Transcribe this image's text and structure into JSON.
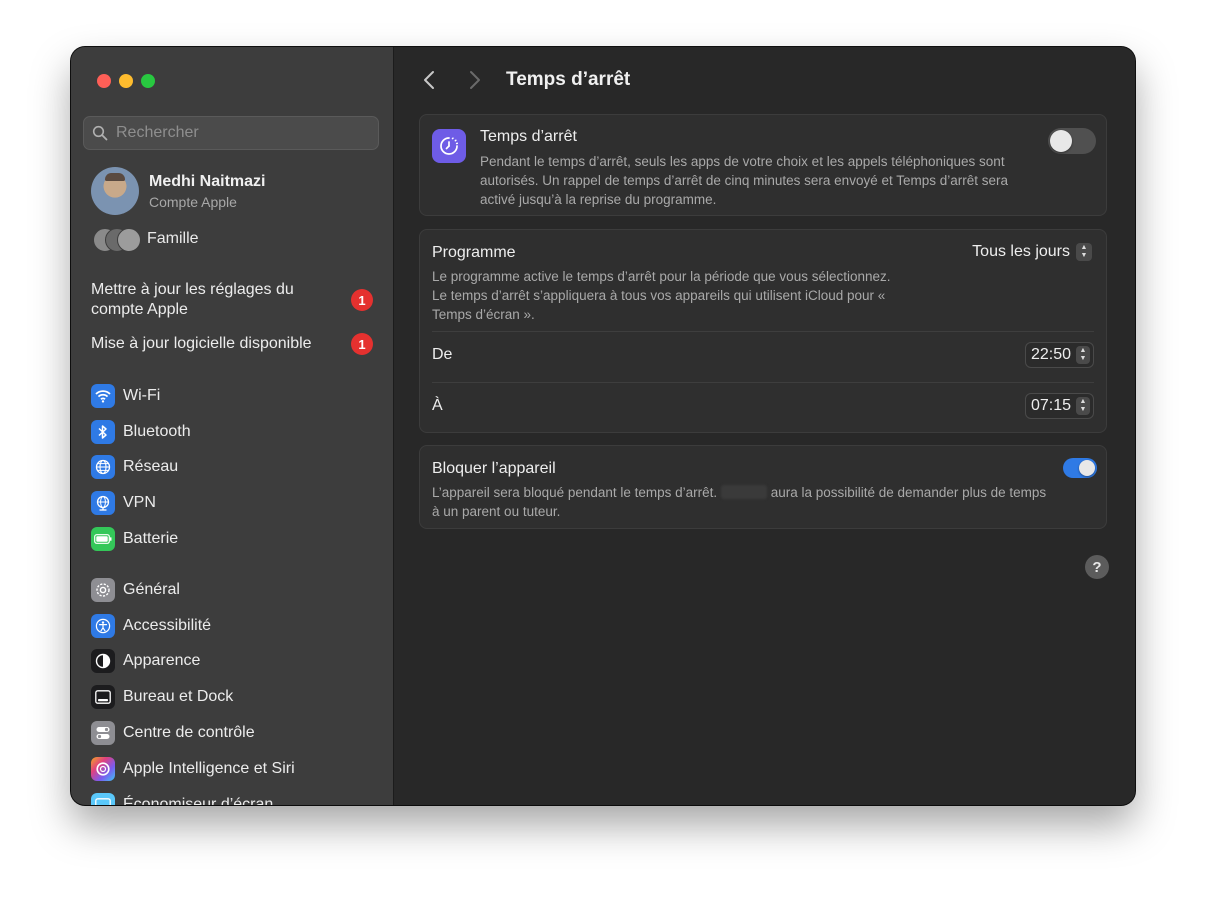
{
  "window": {
    "page_title": "Temps d’arrêt"
  },
  "search": {
    "placeholder": "Rechercher"
  },
  "account": {
    "name": "Medhi Naitmazi",
    "subtitle": "Compte Apple"
  },
  "family": {
    "label": "Famille"
  },
  "alerts": [
    {
      "label": "Mettre à jour les réglages du compte Apple",
      "badge": "1"
    },
    {
      "label": "Mise à jour logicielle disponible",
      "badge": "1"
    }
  ],
  "sidebar": {
    "network_items": [
      {
        "label": "Wi-Fi",
        "icon": "wifi-icon",
        "color": "#2f7ae5"
      },
      {
        "label": "Bluetooth",
        "icon": "bluetooth-icon",
        "color": "#2f7ae5"
      },
      {
        "label": "Réseau",
        "icon": "globe-icon",
        "color": "#2f7ae5"
      },
      {
        "label": "VPN",
        "icon": "vpn-globe-icon",
        "color": "#2f7ae5"
      },
      {
        "label": "Batterie",
        "icon": "battery-icon",
        "color": "#34c759"
      }
    ],
    "system_items": [
      {
        "label": "Général",
        "icon": "gear-icon",
        "color": "#8e8e93"
      },
      {
        "label": "Accessibilité",
        "icon": "accessibility-icon",
        "color": "#2f7ae5"
      },
      {
        "label": "Apparence",
        "icon": "appearance-icon",
        "color": "#1c1c1e"
      },
      {
        "label": "Bureau et Dock",
        "icon": "dock-icon",
        "color": "#1c1c1e"
      },
      {
        "label": "Centre de contrôle",
        "icon": "control-center-icon",
        "color": "#8e8e93"
      },
      {
        "label": "Apple Intelligence et Siri",
        "icon": "siri-icon",
        "color": "#c86dd7"
      },
      {
        "label": "Économiseur d’écran",
        "icon": "screensaver-icon",
        "color": "#5ac8fa"
      }
    ]
  },
  "downtime": {
    "title": "Temps d’arrêt",
    "description": "Pendant le temps d’arrêt, seuls les apps de votre choix et les appels téléphoniques sont autorisés. Un rappel de temps d’arrêt de cinq minutes sera envoyé et Temps d’arrêt sera activé jusqu’à la reprise du programme.",
    "enabled": false,
    "icon_color": "#6e5ce6"
  },
  "schedule": {
    "title": "Programme",
    "value": "Tous les jours",
    "description": "Le programme active le temps d’arrêt pour la période que vous sélectionnez. Le temps d’arrêt s’appliquera à tous vos appareils qui utilisent iCloud pour « Temps d’écran ».",
    "from_label": "De",
    "from_value": "22:50",
    "to_label": "À",
    "to_value": "07:15"
  },
  "block": {
    "title": "Bloquer l’appareil",
    "desc_before": "L’appareil sera bloqué pendant le temps d’arrêt.",
    "desc_after": "aura la possibilité de demander plus de temps à un parent ou tuteur.",
    "enabled": true
  },
  "help": {
    "label": "?"
  }
}
